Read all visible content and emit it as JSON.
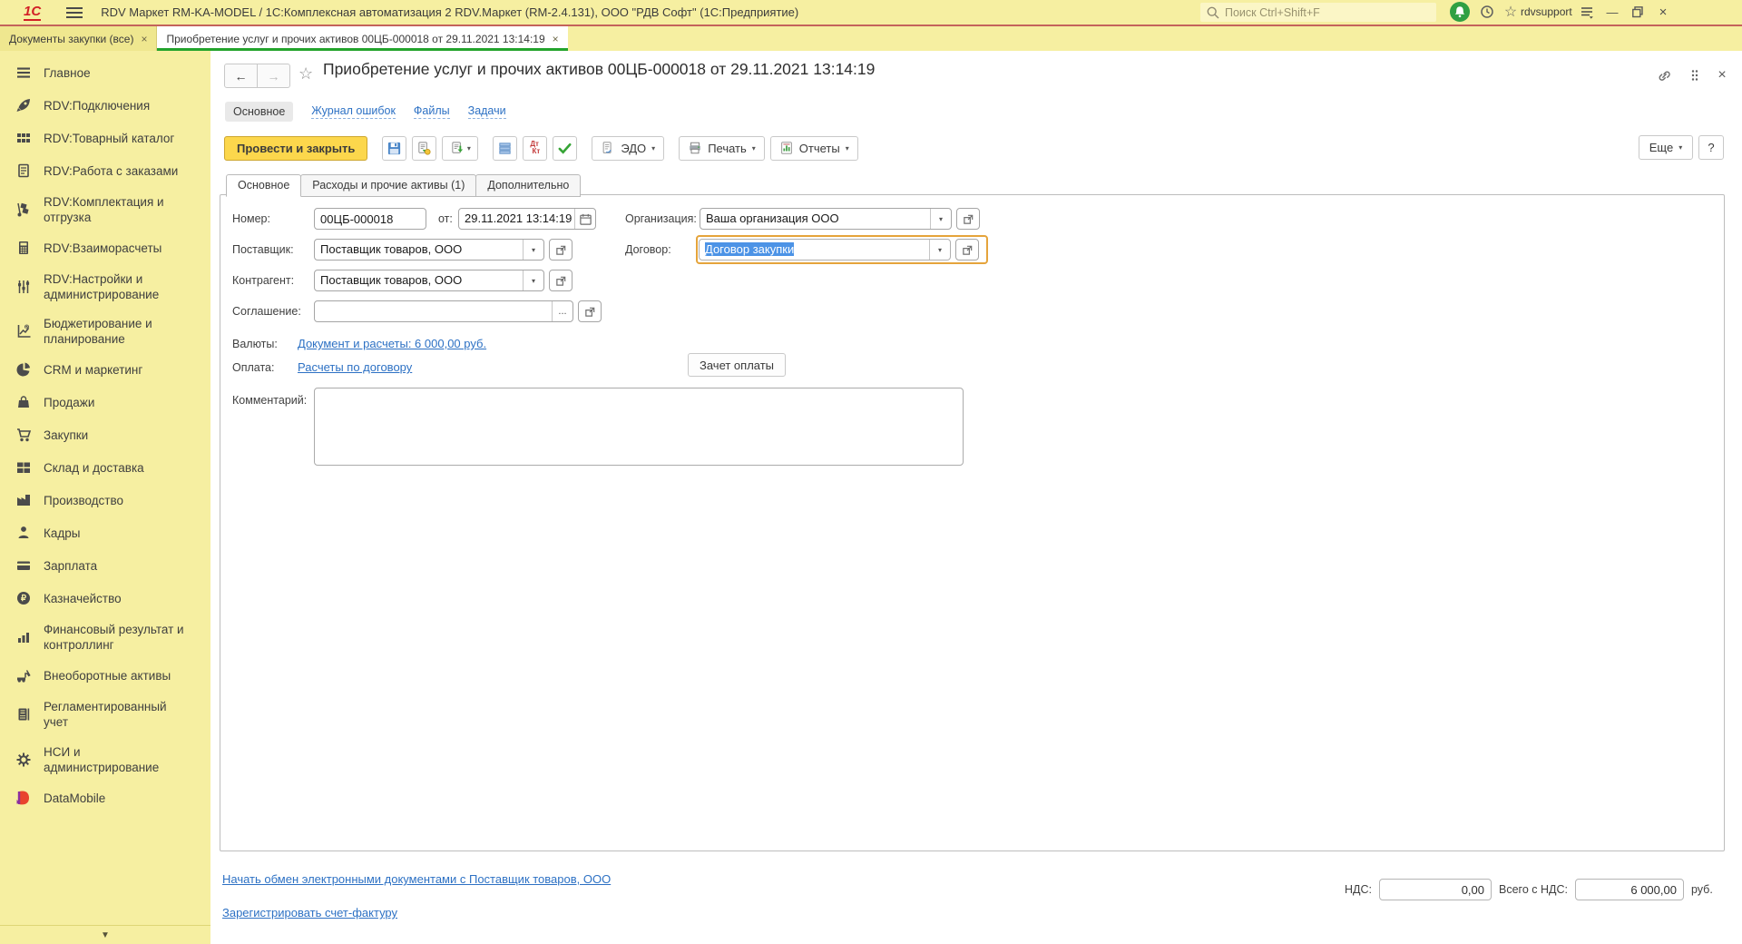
{
  "window": {
    "app_title": "RDV Маркет RM-KA-MODEL / 1С:Комплексная автоматизация 2 RDV.Маркет (RM-2.4.131), ООО \"РДВ Софт\"  (1С:Предприятие)",
    "search_placeholder": "Поиск Ctrl+Shift+F",
    "user": "rdvsupport"
  },
  "colors": {
    "titlebar_yellow": "#f6efa1",
    "accent_red_line": "#c4635b",
    "active_tab_green": "#23a32c",
    "link_blue": "#2d71c4",
    "action_yellow": "#fcd74c",
    "focus_orange": "#e5a43b",
    "selection_blue": "#4c93e6"
  },
  "tabs": [
    {
      "label": "Документы закупки (все)",
      "close": "×",
      "active": false
    },
    {
      "label": "Приобретение услуг и прочих активов 00ЦБ-000018 от 29.11.2021 13:14:19",
      "close": "×",
      "active": true
    }
  ],
  "sidebar": {
    "items": [
      {
        "label": "Главное",
        "icon": "menu-icon",
        "two": false
      },
      {
        "label": "RDV:Подключения",
        "icon": "rocket-icon",
        "two": false
      },
      {
        "label": "RDV:Товарный каталог",
        "icon": "catalog-grid-icon",
        "two": false
      },
      {
        "label": "RDV:Работа с заказами",
        "icon": "orders-clipboard-icon",
        "two": false
      },
      {
        "label": "RDV:Комплектация и\nотгрузка",
        "icon": "handtruck-icon",
        "two": true
      },
      {
        "label": "RDV:Взаиморасчеты",
        "icon": "calculator-icon",
        "two": false
      },
      {
        "label": "RDV:Настройки и\nадминистрирование",
        "icon": "sliders-icon",
        "two": true
      },
      {
        "label": "Бюджетирование и\nпланирование",
        "icon": "planning-chart-icon",
        "two": true
      },
      {
        "label": "CRM и маркетинг",
        "icon": "pie-chart-icon",
        "two": false
      },
      {
        "label": "Продажи",
        "icon": "shopping-bag-icon",
        "two": false
      },
      {
        "label": "Закупки",
        "icon": "shopping-cart-icon",
        "two": false
      },
      {
        "label": "Склад и доставка",
        "icon": "warehouse-boxes-icon",
        "two": false
      },
      {
        "label": "Производство",
        "icon": "factory-icon",
        "two": false
      },
      {
        "label": "Кадры",
        "icon": "person-icon",
        "two": false
      },
      {
        "label": "Зарплата",
        "icon": "pay-card-icon",
        "two": false
      },
      {
        "label": "Казначейство",
        "icon": "ruble-circle-icon",
        "two": false
      },
      {
        "label": "Финансовый результат и\nконтроллинг",
        "icon": "bar-chart-icon",
        "two": true
      },
      {
        "label": "Внеоборотные активы",
        "icon": "assets-truck-icon",
        "two": false
      },
      {
        "label": "Регламентированный учет",
        "icon": "ledger-icon",
        "two": false
      },
      {
        "label": "НСИ и\nадминистрирование",
        "icon": "gear-icon",
        "two": true
      },
      {
        "label": "DataMobile",
        "icon": "datamobile-logo-icon",
        "two": false
      }
    ]
  },
  "doc": {
    "title": "Приобретение услуг и прочих активов 00ЦБ-000018 от 29.11.2021 13:14:19",
    "nav": {
      "main": "Основное",
      "errors": "Журнал ошибок",
      "files": "Файлы",
      "tasks": "Задачи"
    },
    "toolbar": {
      "post_close": "Провести и закрыть",
      "edo": "ЭДО",
      "print": "Печать",
      "reports": "Отчеты",
      "more": "Еще",
      "help": "?"
    },
    "form_tabs": {
      "t1": "Основное",
      "t2": "Расходы и прочие активы (1)",
      "t3": "Дополнительно"
    },
    "fields": {
      "number_label": "Номер:",
      "number_value": "00ЦБ-000018",
      "date_label": "от:",
      "date_value": "29.11.2021 13:14:19",
      "org_label": "Организация:",
      "org_value": "Ваша организация ООО",
      "supplier_label": "Поставщик:",
      "supplier_value": "Поставщик товаров, ООО",
      "contract_label": "Договор:",
      "contract_value": "Договор закупки",
      "counterparty_label": "Контрагент:",
      "counterparty_value": "Поставщик товаров, ООО",
      "agreement_label": "Соглашение:",
      "agreement_value": "",
      "agreement_dots": "...",
      "currency_label": "Валюты:",
      "currency_link": "Документ и расчеты: 6 000,00 руб.",
      "payment_label": "Оплата:",
      "payment_link": "Расчеты по договору",
      "offset_button": "Зачет оплаты",
      "comment_label": "Комментарий:"
    },
    "footer": {
      "edi_link": "Начать обмен электронными документами с Поставщик товаров, ООО",
      "invoice_link": "Зарегистрировать счет-фактуру",
      "vat_label": "НДС:",
      "vat_value": "0,00",
      "total_label": "Всего с НДС:",
      "total_value": "6 000,00",
      "currency": "руб."
    }
  }
}
